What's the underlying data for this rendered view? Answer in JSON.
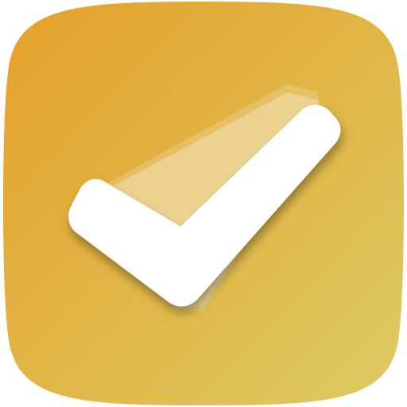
{
  "app_icon": {
    "icon_name": "checkmark-icon",
    "colors": {
      "gradient_start": "#E5A02A",
      "gradient_end": "#DDCB63",
      "check_fill": "#FFFFFF",
      "ghost_fill": "#FFFFFF"
    }
  }
}
